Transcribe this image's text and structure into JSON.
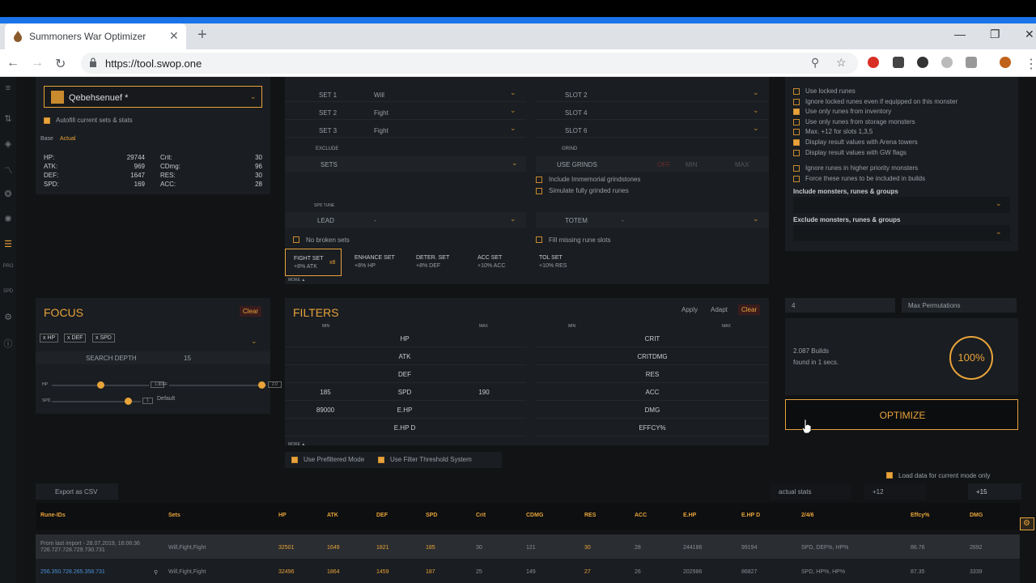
{
  "browser": {
    "tab_title": "Summoners War Optimizer",
    "url": "https://tool.swop.one"
  },
  "monster": {
    "name": "Qebehsenuef *",
    "autofill_label": "Autofill current sets & stats",
    "tab_base": "Base",
    "tab_actual": "Actual",
    "stats_left": [
      {
        "label": "HP:",
        "value": "29744"
      },
      {
        "label": "ATK:",
        "value": "969"
      },
      {
        "label": "DEF:",
        "value": "1647"
      },
      {
        "label": "SPD:",
        "value": "169"
      }
    ],
    "stats_right": [
      {
        "label": "Crit:",
        "value": "30"
      },
      {
        "label": "CDmg:",
        "value": "96"
      },
      {
        "label": "RES:",
        "value": "30"
      },
      {
        "label": "ACC:",
        "value": "28"
      }
    ]
  },
  "sets": {
    "rows": [
      {
        "label": "SET 1",
        "value": "Will"
      },
      {
        "label": "SET 2",
        "value": "Fight"
      },
      {
        "label": "SET 3",
        "value": "Fight"
      }
    ],
    "exclude_label": "EXCLUDE",
    "sets_label": "SETS",
    "spd_tune_label": "SPD TUNE",
    "lead_label": "LEAD",
    "lead_value": "-",
    "no_broken_label": "No broken sets",
    "set_cards": [
      {
        "name": "FIGHT SET",
        "bonus": "+8% ATK",
        "badge": "x8"
      },
      {
        "name": "ENHANCE SET",
        "bonus": "+8% HP"
      },
      {
        "name": "DETER. SET",
        "bonus": "+8% DEF"
      },
      {
        "name": "ACC SET",
        "bonus": "+10% ACC"
      },
      {
        "name": "TOL SET",
        "bonus": "+10% RES"
      }
    ],
    "more_label": "MORE ▲"
  },
  "slots": {
    "rows": [
      {
        "label": "SLOT 2"
      },
      {
        "label": "SLOT 4"
      },
      {
        "label": "SLOT 6"
      }
    ],
    "grind_label": "GRIND",
    "use_grinds": "USE GRINDS",
    "off": "OFF",
    "min": "MIN",
    "max": "MAX",
    "immemorial": "Include Immemorial grindstones",
    "simulate": "Simulate fully grinded runes",
    "totem_label": "TOTEM",
    "totem_value": "-",
    "fill_missing": "Fill missing rune slots"
  },
  "options": {
    "items": [
      {
        "label": "Use locked runes",
        "checked": false
      },
      {
        "label": "Ignore locked runes even if equipped on this monster",
        "checked": false
      },
      {
        "label": "Use only runes from inventory",
        "checked": true
      },
      {
        "label": "Use only runes from storage monsters",
        "checked": false
      },
      {
        "label": "Max. +12 for slots 1,3,5",
        "checked": false
      },
      {
        "label": "Display result values with Arena towers",
        "checked": true
      },
      {
        "label": "Display result values with GW flags",
        "checked": false
      }
    ],
    "items2": [
      {
        "label": "Ignore runes in higher priority monsters",
        "checked": false
      },
      {
        "label": "Force these runes to be included in builds",
        "checked": false
      }
    ],
    "include_label": "Include monsters, runes & groups",
    "exclude_label": "Exclude monsters, runes & groups"
  },
  "focus": {
    "title": "FOCUS",
    "clear": "Clear",
    "tags": [
      "x HP",
      "x DEF",
      "x SPD"
    ],
    "search_depth_label": "SEARCH DEPTH",
    "search_depth_value": "15",
    "sliders": [
      {
        "label": "HP",
        "value": "1.0",
        "level": 0.5
      },
      {
        "label": "DEF",
        "value": "2.0",
        "level": 0.95
      },
      {
        "label": "SPD",
        "value": "1",
        "level": 0.85
      }
    ],
    "default_label": "Default"
  },
  "filters": {
    "title": "FILTERS",
    "apply": "Apply",
    "adapt": "Adapt",
    "clear": "Clear",
    "min": "MIN",
    "max": "MAX",
    "left": [
      {
        "stat": "HP",
        "min": "",
        "max": ""
      },
      {
        "stat": "ATK",
        "min": "",
        "max": ""
      },
      {
        "stat": "DEF",
        "min": "",
        "max": ""
      },
      {
        "stat": "SPD",
        "min": "185",
        "max": "190"
      },
      {
        "stat": "E.HP",
        "min": "89000",
        "max": ""
      },
      {
        "stat": "E.HP D",
        "min": "",
        "max": ""
      }
    ],
    "right": [
      {
        "stat": "CRIT"
      },
      {
        "stat": "CRITDMG"
      },
      {
        "stat": "RES"
      },
      {
        "stat": "ACC"
      },
      {
        "stat": "DMG"
      },
      {
        "stat": "EFFCY%"
      }
    ],
    "more_label": "MORE ▲",
    "prefiltered": "Use Prefiltered Mode",
    "threshold": "Use Filter Threshold System"
  },
  "optimize": {
    "count_value": "4",
    "max_perm_label": "Max Permutations",
    "builds_count": "2.087 Builds",
    "found_text": "found in 1 secs.",
    "percent": "100%",
    "button": "OPTIMIZE",
    "load_label": "Load data for current mode only"
  },
  "results": {
    "export": "Export as CSV",
    "tabs": [
      "actual stats",
      "+12",
      "+15"
    ],
    "columns": [
      "Rune-IDs",
      "Sets",
      "HP",
      "ATK",
      "DEF",
      "SPD",
      "Crit",
      "CDMG",
      "RES",
      "ACC",
      "E.HP",
      "E.HP D",
      "2/4/6",
      "Effcy%",
      "DMG"
    ],
    "rows": [
      {
        "ids": "From last import - 28.07.2019, 16:06:36",
        "ids2": "726.727.728.729.730.731",
        "sets": "Will,Fight,Fight",
        "hp": "32501",
        "atk": "1649",
        "def": "1821",
        "spd": "185",
        "crit": "30",
        "cdmg": "121",
        "res": "30",
        "acc": "28",
        "ehp": "244186",
        "ehpd": "99194",
        "slots": "SPD, DEF%, HP%",
        "effcy": "86.76",
        "dmg": "2692"
      },
      {
        "ids": "256.350.728.265.358.731",
        "ids2": "",
        "sets": "Will,Fight,Fight",
        "hp": "32496",
        "atk": "1864",
        "def": "1459",
        "spd": "187",
        "crit": "25",
        "cdmg": "149",
        "res": "27",
        "acc": "26",
        "ehp": "202986",
        "ehpd": "86827",
        "slots": "SPD, HP%, HP%",
        "effcy": "87.35",
        "dmg": "3339"
      }
    ]
  },
  "colors": {
    "accent": "#e8a33a",
    "bg": "#111315",
    "panel": "#1a1d21"
  }
}
